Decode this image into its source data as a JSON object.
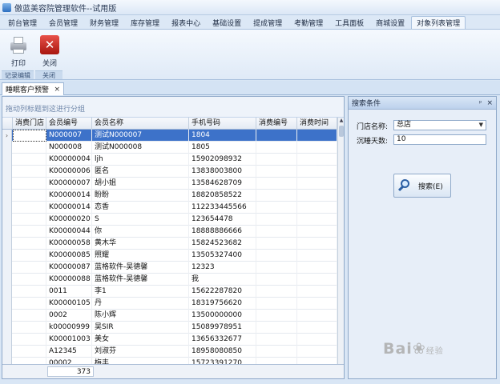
{
  "app": {
    "title": "傲蓝美容院管理软件--试用版"
  },
  "menu": {
    "tabs": [
      {
        "label": "前台管理"
      },
      {
        "label": "会员管理"
      },
      {
        "label": "财务管理"
      },
      {
        "label": "库存管理"
      },
      {
        "label": "报表中心"
      },
      {
        "label": "基础设置"
      },
      {
        "label": "提成管理"
      },
      {
        "label": "考勤管理"
      },
      {
        "label": "工具面板"
      },
      {
        "label": "商城设置"
      },
      {
        "label": "对象列表管理"
      }
    ],
    "active_index": 10
  },
  "ribbon": {
    "print_label": "打印",
    "close_label": "关闭",
    "group_record": "记录编辑",
    "group_close": "关闭"
  },
  "doc_tab": {
    "label": "睡眠客户预警",
    "close": "×"
  },
  "grid": {
    "group_hint": "拖动列标题到这进行分组",
    "columns": [
      "消费门店",
      "会员编号",
      "会员名称",
      "手机号码",
      "消费编号",
      "消费时间"
    ],
    "rows": [
      [
        "",
        "N000007",
        "测试N000007",
        "1804",
        "",
        ""
      ],
      [
        "",
        "N000008",
        "测试N000008",
        "1805",
        "",
        ""
      ],
      [
        "",
        "K00000004",
        "ljh",
        "15902098932",
        "",
        ""
      ],
      [
        "",
        "K00000006",
        "匿名",
        "13838003800",
        "",
        ""
      ],
      [
        "",
        "K00000007",
        "胡小姐",
        "13584628709",
        "",
        ""
      ],
      [
        "",
        "K00000014",
        "盼盼",
        "18820858522",
        "",
        ""
      ],
      [
        "",
        "K00000014",
        "恋香",
        "112233445566",
        "",
        ""
      ],
      [
        "",
        "K00000020",
        "S",
        "123654478",
        "",
        ""
      ],
      [
        "",
        "K00000044",
        "你",
        "18888886666",
        "",
        ""
      ],
      [
        "",
        "K00000058",
        "黄木华",
        "15824523682",
        "",
        ""
      ],
      [
        "",
        "K00000085",
        "照耀",
        "13505327400",
        "",
        ""
      ],
      [
        "",
        "K00000087",
        "蓝格软件-吴德馨",
        "12323",
        "",
        ""
      ],
      [
        "",
        "K00000088",
        "蓝格软件-吴德馨",
        "我",
        "",
        ""
      ],
      [
        "",
        "0011",
        "李1",
        "15622287820",
        "",
        ""
      ],
      [
        "",
        "K00000105",
        "丹",
        "18319756620",
        "",
        ""
      ],
      [
        "",
        "0002",
        "陈小辉",
        "13500000000",
        "",
        ""
      ],
      [
        "",
        "k00000999",
        "吴SIR",
        "15089978951",
        "",
        ""
      ],
      [
        "",
        "K00001003",
        "美女",
        "13656332677",
        "",
        ""
      ],
      [
        "",
        "A12345",
        "刘淑芬",
        "18958080850",
        "",
        ""
      ],
      [
        "",
        "00002",
        "梅丰",
        "15723391270",
        "",
        ""
      ]
    ],
    "selected_row": 0,
    "row_indicator": "›",
    "total_count": "373"
  },
  "search_panel": {
    "title": "搜索条件",
    "pin": "ᵖ",
    "close": "×",
    "store_label": "门店名称:",
    "store_value": "总店",
    "sleep_days_label": "沉睡天数:",
    "sleep_days_value": "10",
    "search_button": "搜索(E)"
  },
  "watermark": {
    "text": "Bai",
    "paw": "❀",
    "tail": "经验"
  }
}
